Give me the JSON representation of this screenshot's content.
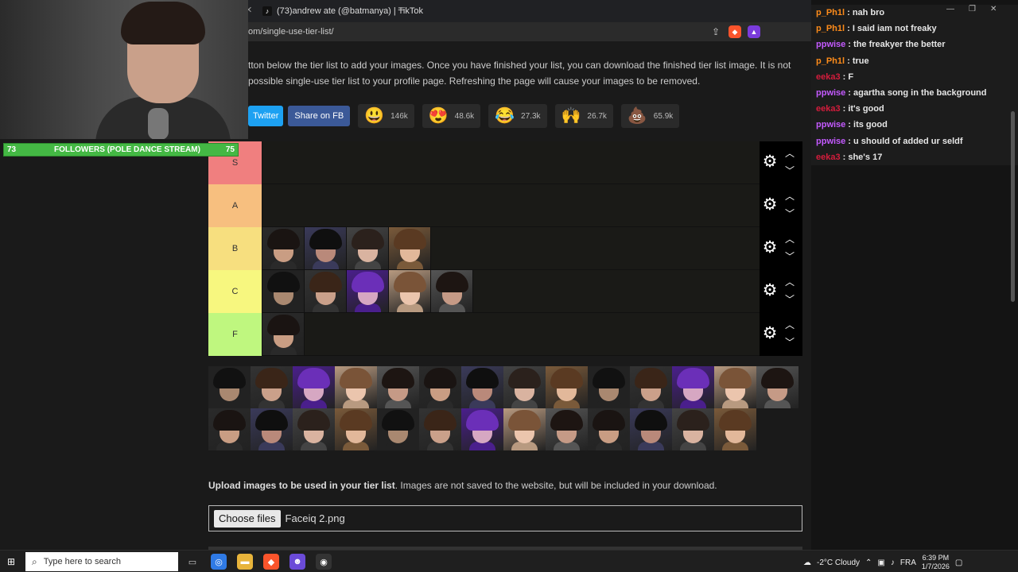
{
  "browser": {
    "tab_title": "(73)andrew ate (@batmanya) | TikTok",
    "tab_icon": "tiktok-icon",
    "url": "om/single-use-tier-list/"
  },
  "page": {
    "description": "tton below the tier list to add your images. Once you have finished your list, you can download the finished tier list image. It is not possible single-use tier list to your profile page. Refreshing the page will cause your images to be removed.",
    "share": {
      "twitter": "Twitter",
      "facebook": "Share on FB"
    },
    "reactions": [
      {
        "emoji": "😃",
        "count": "146k"
      },
      {
        "emoji": "😍",
        "count": "48.6k"
      },
      {
        "emoji": "😂",
        "count": "27.3k"
      },
      {
        "emoji": "🙌",
        "count": "26.7k"
      },
      {
        "emoji": "💩",
        "count": "65.9k"
      }
    ],
    "tiers": [
      {
        "label": "S",
        "color": "#f07f7f",
        "items": 0
      },
      {
        "label": "A",
        "color": "#f7bf7f",
        "items": 0
      },
      {
        "label": "B",
        "color": "#f7df7f",
        "items": 4
      },
      {
        "label": "C",
        "color": "#f7f77f",
        "items": 5
      },
      {
        "label": "F",
        "color": "#bff77f",
        "items": 1
      }
    ],
    "pool_count": 27,
    "upload_bold": "Upload images to be used in your tier list",
    "upload_rest": ". Images are not saved to the website, but will be included in your download.",
    "choose_files": "Choose files",
    "file_name": "Faceiq 2.png"
  },
  "overlay": {
    "followers_left": "73",
    "followers_label": "FOLLOWERS (POLE DANCE STREAM)",
    "followers_right": "75",
    "followers_color": "#44b844"
  },
  "chat": [
    {
      "user": "p_Ph1l",
      "color": "#ff8c1a",
      "text": "nah bro"
    },
    {
      "user": "p_Ph1l",
      "color": "#ff8c1a",
      "text": "I said iam not freaky"
    },
    {
      "user": "ppwise",
      "color": "#c45aff",
      "text": "the freakyer the better"
    },
    {
      "user": "p_Ph1l",
      "color": "#ff8c1a",
      "text": "true"
    },
    {
      "user": "eeka3",
      "color": "#d41c3c",
      "text": "F"
    },
    {
      "user": "ppwise",
      "color": "#c45aff",
      "text": "agartha song in the background"
    },
    {
      "user": "eeka3",
      "color": "#d41c3c",
      "text": "it's good"
    },
    {
      "user": "ppwise",
      "color": "#c45aff",
      "text": "its good"
    },
    {
      "user": "ppwise",
      "color": "#c45aff",
      "text": "u should of added ur seldf"
    },
    {
      "user": "eeka3",
      "color": "#d41c3c",
      "text": "she's 17"
    }
  ],
  "taskbar": {
    "search_placeholder": "Type here to search",
    "weather": "-2°C  Cloudy",
    "lang": "FRA",
    "time": "6:39 PM",
    "date": "1/7/2026"
  }
}
